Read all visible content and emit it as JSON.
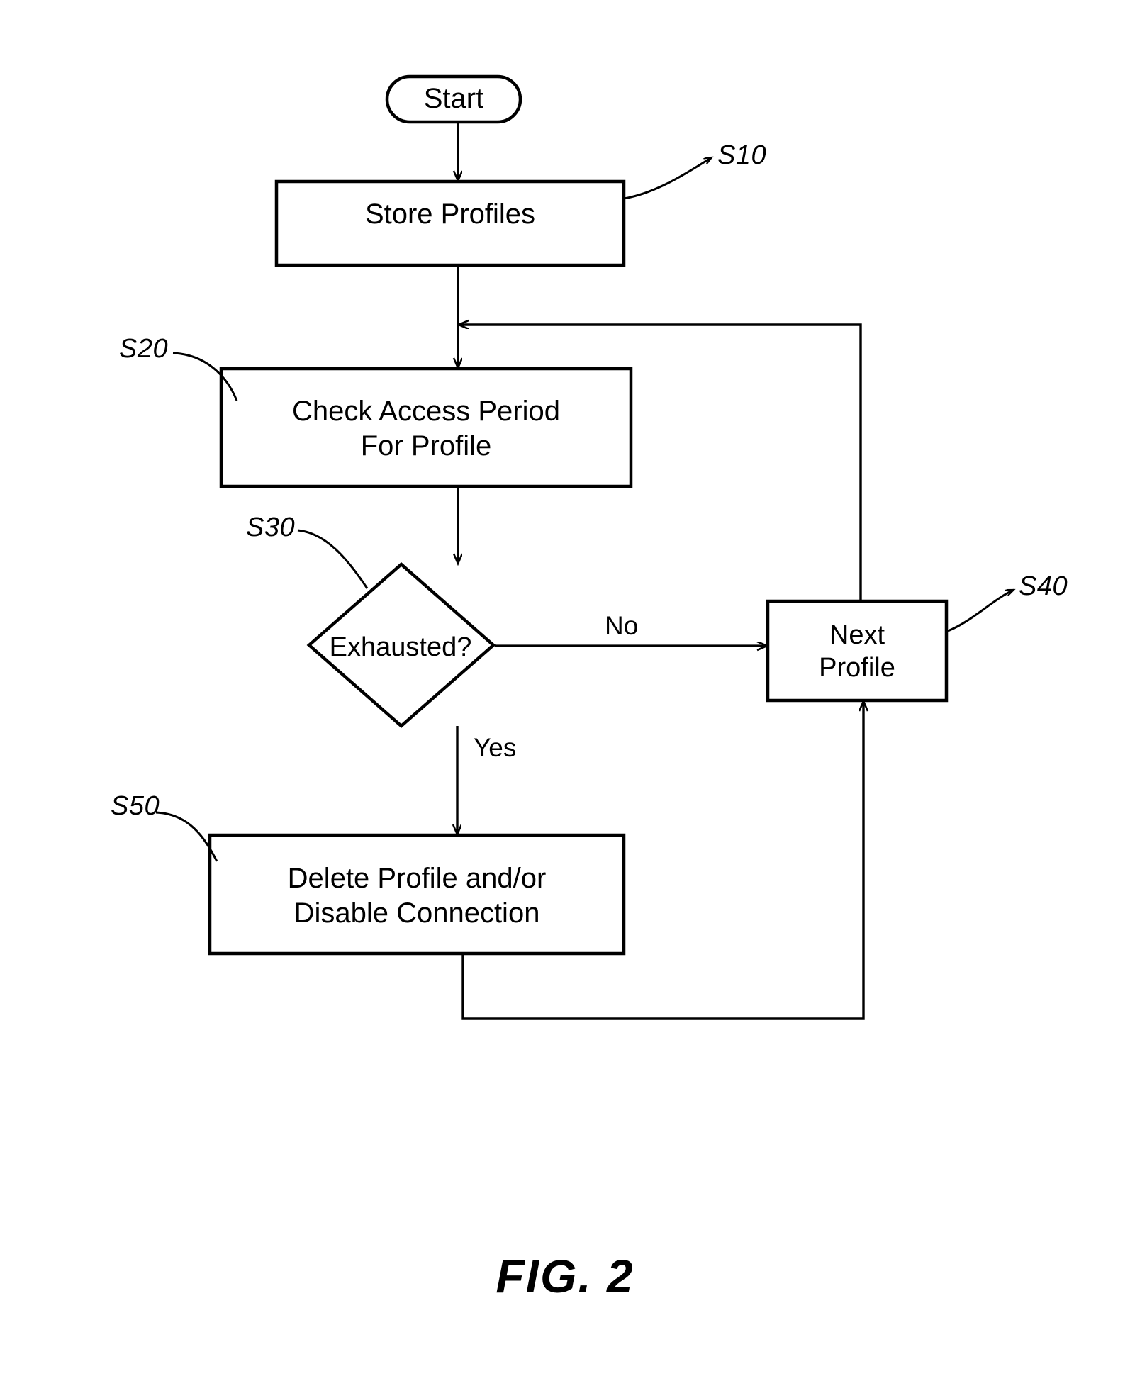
{
  "figure": {
    "caption": "FIG. 2",
    "type": "flowchart"
  },
  "nodes": {
    "start": {
      "label": "Start",
      "shape": "terminator",
      "ref": ""
    },
    "s10": {
      "label": "Store Profiles",
      "shape": "process",
      "ref": "S10"
    },
    "s20": {
      "label": "Check Access Period\nFor Profile",
      "shape": "process",
      "ref": "S20"
    },
    "s30": {
      "label": "Exhausted?",
      "shape": "decision",
      "ref": "S30"
    },
    "s40": {
      "label": "Next\nProfile",
      "shape": "process",
      "ref": "S40"
    },
    "s50": {
      "label": "Delete Profile and/or\nDisable Connection",
      "shape": "process",
      "ref": "S50"
    }
  },
  "edge_labels": {
    "no": "No",
    "yes": "Yes"
  },
  "colors": {
    "stroke": "#000000",
    "background": "#ffffff",
    "text": "#000000"
  }
}
